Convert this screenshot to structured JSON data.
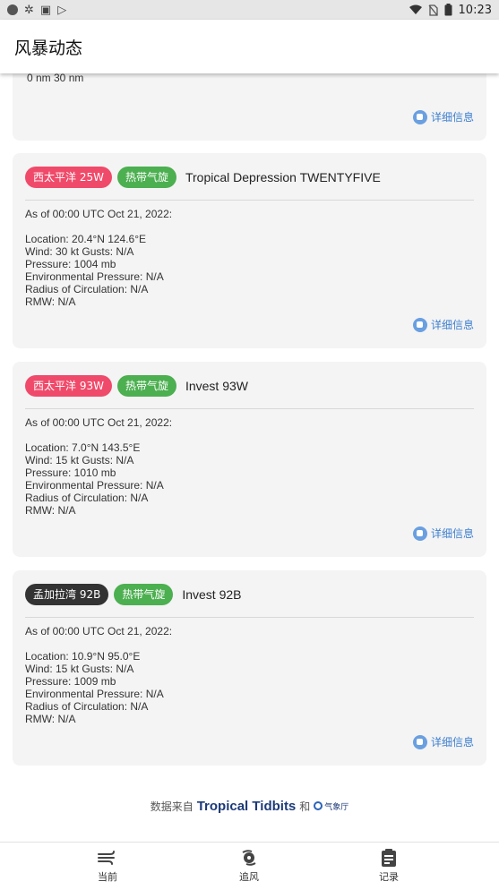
{
  "app": {
    "title": "风暴动态"
  },
  "status_bar": {
    "time": "10:23"
  },
  "partial_card": {
    "lines": [
      "0 nm  30 nm"
    ],
    "detail_label": "详细信息"
  },
  "cards": [
    {
      "region_chip": "西太平洋 25W",
      "region_color": "#f04a6a",
      "type_chip": "热带气旋",
      "type_color": "#4caf50",
      "name": "Tropical Depression TWENTYFIVE",
      "as_of": "As of 00:00 UTC Oct 21, 2022:",
      "location": "Location: 20.4°N 124.6°E",
      "wind": "Wind: 30 kt  Gusts: N/A",
      "pressure": "Pressure: 1004 mb",
      "env_pressure": "Environmental Pressure: N/A",
      "radius": "Radius of Circulation: N/A",
      "rmw": "RMW: N/A",
      "detail_label": "详细信息"
    },
    {
      "region_chip": "西太平洋 93W",
      "region_color": "#f04a6a",
      "type_chip": "热带气旋",
      "type_color": "#4caf50",
      "name": "Invest 93W",
      "as_of": "As of 00:00 UTC Oct 21, 2022:",
      "location": "Location: 7.0°N 143.5°E",
      "wind": "Wind: 15 kt  Gusts: N/A",
      "pressure": "Pressure: 1010 mb",
      "env_pressure": "Environmental Pressure: N/A",
      "radius": "Radius of Circulation: N/A",
      "rmw": "RMW: N/A",
      "detail_label": "详细信息"
    },
    {
      "region_chip": "孟加拉湾 92B",
      "region_color": "#333333",
      "type_chip": "热带气旋",
      "type_color": "#4caf50",
      "name": "Invest 92B",
      "as_of": "As of 00:00 UTC Oct 21, 2022:",
      "location": "Location: 10.9°N 95.0°E",
      "wind": "Wind: 15 kt  Gusts: N/A",
      "pressure": "Pressure: 1009 mb",
      "env_pressure": "Environmental Pressure: N/A",
      "radius": "Radius of Circulation: N/A",
      "rmw": "RMW: N/A",
      "detail_label": "详细信息"
    }
  ],
  "credit": {
    "prefix": "数据来自",
    "brand": "Tropical Tidbits",
    "conjunction": "和",
    "agency": "气象厅"
  },
  "bottom_nav": [
    {
      "label": "当前",
      "icon": "wind-icon"
    },
    {
      "label": "追风",
      "icon": "typhoon-icon"
    },
    {
      "label": "记录",
      "icon": "clipboard-icon"
    }
  ],
  "colors": {
    "accent_link": "#3d7fcf",
    "card_bg": "#f4f4f4"
  }
}
